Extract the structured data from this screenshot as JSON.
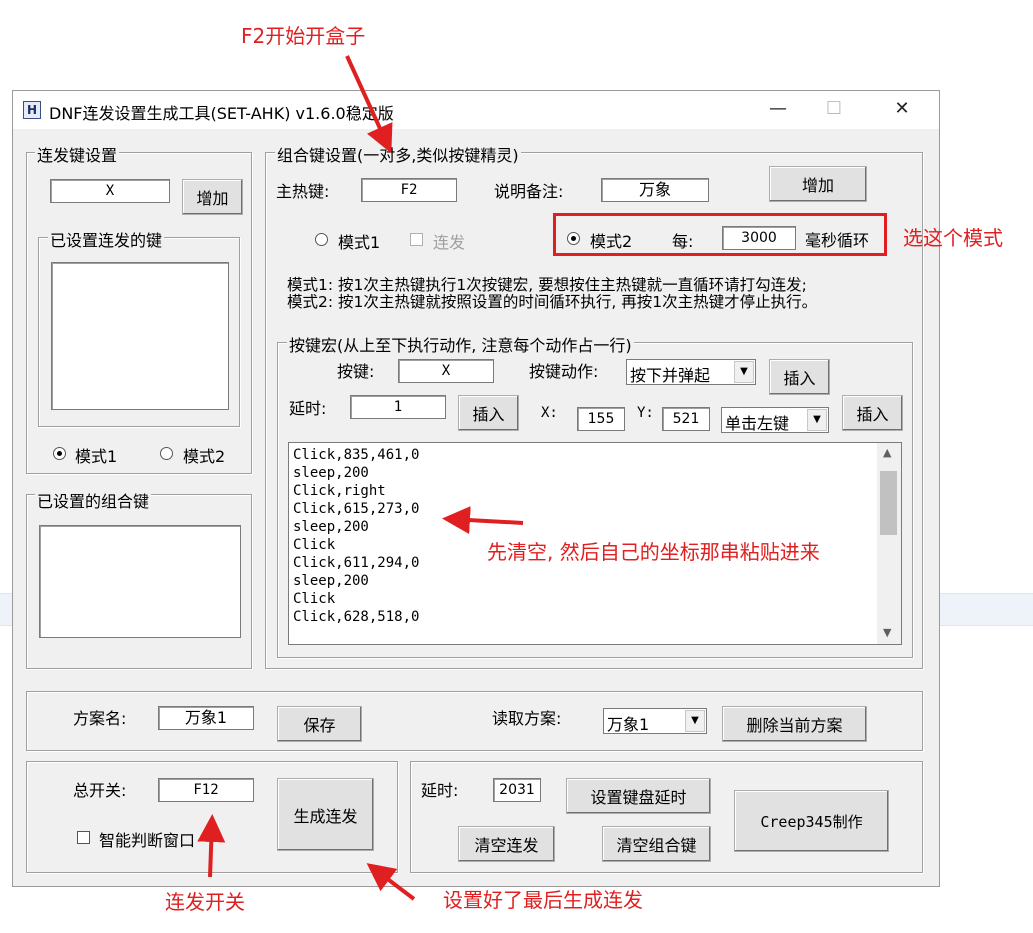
{
  "window": {
    "icon_letter": "H",
    "title": "DNF连发设置生成工具(SET-AHK) v1.6.0稳定版",
    "minimize": "—",
    "maximize": "☐",
    "close": "✕"
  },
  "burst_settings": {
    "group_title": "连发键设置",
    "key_value": "X",
    "add_label": "增加",
    "set_keys_title": "已设置连发的键",
    "mode1_label": "模式1",
    "mode2_label": "模式2"
  },
  "combo_list": {
    "group_title": "已设置的组合键"
  },
  "combo_settings": {
    "group_title": "组合键设置(一对多,类似按键精灵)",
    "hotkey_label": "主热键:",
    "hotkey_value": "F2",
    "note_label": "说明备注:",
    "note_value": "万象",
    "add_label": "增加",
    "mode1_label": "模式1",
    "repeat_label": "连发",
    "mode2_label": "模式2",
    "every_label": "每:",
    "interval_value": "3000",
    "interval_unit": "毫秒循环",
    "help_line1": "模式1: 按1次主热键执行1次按键宏, 要想按住主热键就一直循环请打勾连发;",
    "help_line2": "模式2: 按1次主热键就按照设置的时间循环执行, 再按1次主热键才停止执行。"
  },
  "macro": {
    "group_title": "按键宏(从上至下执行动作, 注意每个动作占一行)",
    "key_label": "按键:",
    "key_value": "X",
    "action_label": "按键动作:",
    "action_value": "按下并弹起",
    "insert_label": "插入",
    "delay_label": "延时:",
    "delay_value": "1",
    "x_label": "X:",
    "x_value": "155",
    "y_label": "Y:",
    "y_value": "521",
    "click_value": "单击左键",
    "script_lines": [
      "Click,835,461,0",
      "sleep,200",
      "Click,right",
      "Click,615,273,0",
      "sleep,200",
      "Click",
      "Click,611,294,0",
      "sleep,200",
      "Click",
      "Click,628,518,0"
    ]
  },
  "scheme": {
    "name_label": "方案名:",
    "name_value": "万象1",
    "save_label": "保存",
    "load_label": "读取方案:",
    "load_value": "万象1",
    "delete_label": "删除当前方案"
  },
  "master": {
    "switch_label": "总开关:",
    "switch_value": "F12",
    "smart_window_label": "智能判断窗口",
    "generate_label": "生成连发"
  },
  "misc": {
    "delay_label": "延时:",
    "delay_value": "2031",
    "keyboard_delay_label": "设置键盘延时",
    "clear_burst_label": "清空连发",
    "clear_combo_label": "清空组合键",
    "author_label": "Creep345制作"
  },
  "annotations": {
    "f2_note": "F2开始开盒子",
    "mode_note": "选这个模式",
    "paste_note": "先清空, 然后自己的坐标那串粘贴进来",
    "switch_note": "连发开关",
    "generate_note": "设置好了最后生成连发",
    "color": "#e02020"
  }
}
